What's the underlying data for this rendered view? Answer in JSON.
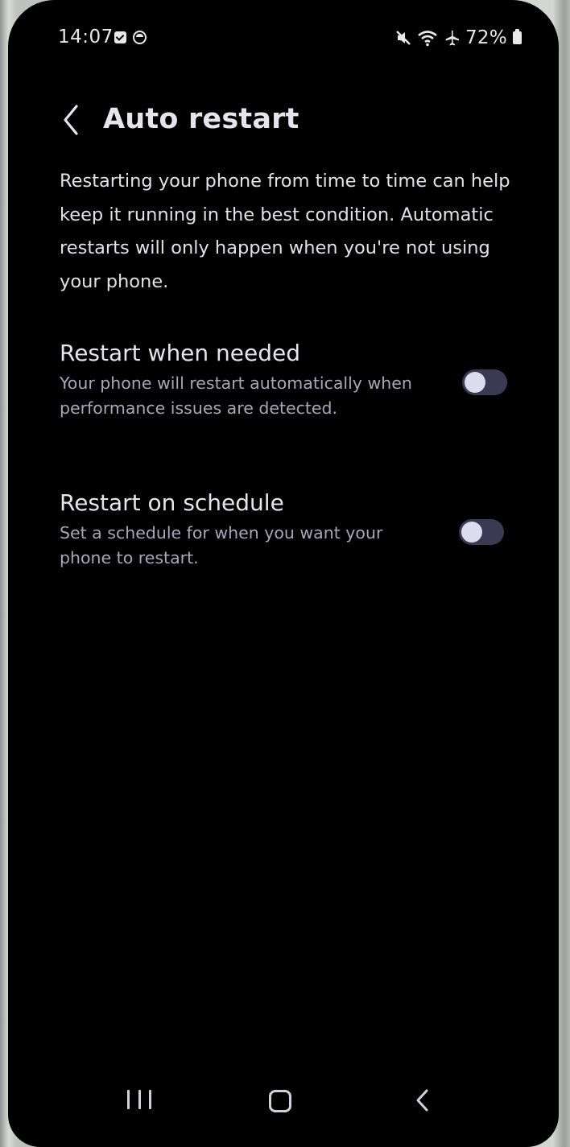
{
  "status_bar": {
    "time": "14:07",
    "left_icons": [
      "checklist-icon",
      "circle-icon"
    ],
    "right_icons": [
      "mute-icon",
      "wifi-icon",
      "airplane-icon"
    ],
    "battery_percent": "72%"
  },
  "header": {
    "back_icon": "chevron-left-icon",
    "title": "Auto restart"
  },
  "description": "Restarting your phone from time to time can help keep it running in the best condition. Automatic restarts will only happen when you're not using your phone.",
  "settings": [
    {
      "title": "Restart when needed",
      "description": "Your phone will restart automatically when performance issues are detected.",
      "toggle_on": false
    },
    {
      "title": "Restart on schedule",
      "description": "Set a schedule for when you want your phone to restart.",
      "toggle_on": false
    }
  ],
  "nav_bar": {
    "icons": [
      "recents-icon",
      "home-icon",
      "back-icon"
    ]
  },
  "colors": {
    "background": "#000000",
    "text_primary": "#e6e6ea",
    "text_secondary": "#a8a6b8",
    "toggle_track_off": "#3c3a52",
    "toggle_knob": "#dddbee"
  }
}
